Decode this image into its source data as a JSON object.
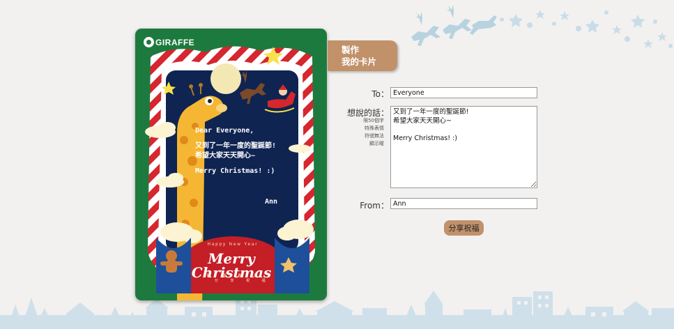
{
  "card": {
    "brand": "GIRAFFE",
    "message_lines": [
      "Dear Everyone,",
      "又到了一年一度的聖誕節!",
      "希望大家天天開心~",
      "Merry Christmas! :)"
    ],
    "signature": "Ann",
    "banner_top": "Happy New Year",
    "banner_main": "Merry Christmas",
    "banner_sub": "歡 慶 聖 誕 　 分 享 祝 福"
  },
  "tab": {
    "line1": "製作",
    "line2": "我的卡片"
  },
  "form": {
    "to_label": "To：",
    "to_value": "Everyone",
    "message_label": "想說的話：",
    "message_hint": [
      "限50個字",
      "特殊表情",
      "符號無法",
      "顯示喔"
    ],
    "message_value": "又到了一年一度的聖誕節!\n希望大家天天開心~\n\nMerry Christmas! :)",
    "from_label": "From：",
    "from_value": "Ann",
    "share_label": "分享祝福"
  },
  "colors": {
    "background": "#f2f1f0",
    "card_green": "#1d7a3e",
    "accent": "#c1916a",
    "frame_red": "#d6262e",
    "night": "#0f2451"
  },
  "icons": [
    "reindeer-sleigh-icon",
    "snowflake-icon",
    "star-icon",
    "giraffe-icon",
    "santa-sleigh-icon",
    "gingerbread-icon"
  ]
}
